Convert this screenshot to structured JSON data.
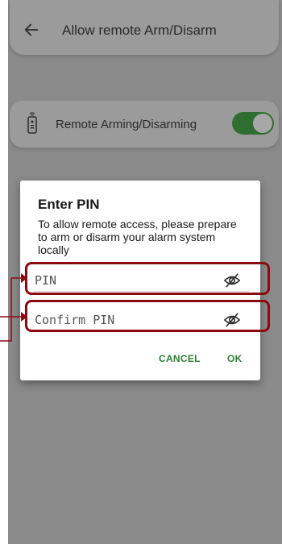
{
  "app_bar": {
    "title": "Allow remote Arm/Disarm",
    "back_icon": "arrow-left-icon"
  },
  "setting": {
    "label": "Remote Arming/Disarming",
    "icon": "remote-control-icon",
    "enabled": true
  },
  "dialog": {
    "title": "Enter PIN",
    "message": "To allow remote access, please prepare to arm or disarm your alarm system locally",
    "pin_field": {
      "placeholder": "PIN",
      "value": "",
      "icon": "eye-off-icon"
    },
    "confirm_field": {
      "placeholder": "Confirm PIN",
      "value": "",
      "icon": "eye-off-icon"
    },
    "cancel_label": "CANCEL",
    "ok_label": "OK"
  },
  "colors": {
    "accent": "#2e7d32",
    "highlight": "#8b0a10",
    "overlay": "#8a8a8a"
  }
}
